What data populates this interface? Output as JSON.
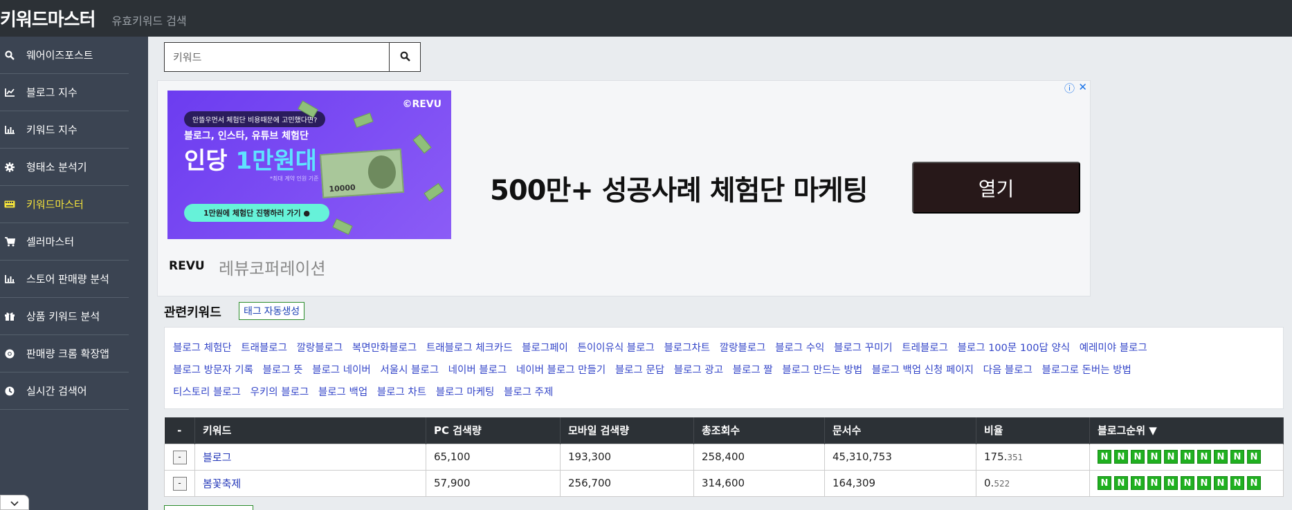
{
  "header": {
    "brand": "키워드마스터",
    "subtitle": "유효키워드 검색"
  },
  "sidebar": {
    "items": [
      {
        "label": "웨어이즈포스트",
        "icon": "search-icon"
      },
      {
        "label": "블로그 지수",
        "icon": "line-chart-icon"
      },
      {
        "label": "키워드 지수",
        "icon": "bar-chart-icon"
      },
      {
        "label": "형태소 분석기",
        "icon": "gear-icon"
      },
      {
        "label": "키워드마스터",
        "icon": "keyboard-icon",
        "active": true
      },
      {
        "label": "셀러마스터",
        "icon": "cart-icon"
      },
      {
        "label": "스토어 판매량 분석",
        "icon": "bar-chart-icon"
      },
      {
        "label": "상품 키워드 분석",
        "icon": "gift-icon"
      },
      {
        "label": "판매량 크롬 확장앱",
        "icon": "chrome-icon"
      },
      {
        "label": "실시간 검색어",
        "icon": "clock-icon"
      }
    ],
    "active_color": "#f5e33a"
  },
  "search": {
    "placeholder": "키워드",
    "value": ""
  },
  "ad": {
    "banner_pill": "안뜰우먼서 체험단 비용때문에 고민했다면?",
    "banner_logo": "©REVU",
    "banner_line1": "블로그, 인스타, 유튜브 체험단",
    "banner_line2_a": "인당 ",
    "banner_line2_b": "1만원대",
    "banner_note": "*최대 계약 인원 기준",
    "banner_bill": "10000",
    "banner_cta": "1만원에 체험단 진행하러 가기 ●",
    "headline": "500만+ 성공사례 체험단 마케팅",
    "open_label": "열기",
    "advertiser_logo": "REVU",
    "advertiser_name": "레뷰코퍼레이션",
    "info_icon": "ⓘ",
    "close_icon": "✕"
  },
  "related": {
    "title": "관련키워드",
    "tag_button": "태그 자동생성",
    "keywords": [
      "블로그 체험단",
      "트래블로그",
      "깔랑블로그",
      "복면만화블로그",
      "트래블로그 체크카드",
      "블로그페이",
      "튼이이유식 블로그",
      "블로그차트",
      "깔랑블로그",
      "블로그 수익",
      "블로그 꾸미기",
      "트레블로그",
      "블로그 100문 100답 양식",
      "예레미야 블로그",
      "블로그 방문자 기록",
      "블로그 뜻",
      "블로그 네이버",
      "서울시 블로그",
      "네이버 블로그",
      "네이버 블로그 만들기",
      "블로그 문답",
      "블로그 광고",
      "블로그 짤",
      "블로그 만드는 방법",
      "블로그 백업 신청 페이지",
      "다음 블로그",
      "블로그로 돈버는 방법",
      "티스토리 블로그",
      "우키의 블로그",
      "블로그 백업",
      "블로그 차트",
      "블로그 마케팅",
      "블로그 주제"
    ]
  },
  "table": {
    "headers": [
      "-",
      "키워드",
      "PC 검색량",
      "모바일 검색량",
      "총조회수",
      "문서수",
      "비율",
      "블로그순위 ▼"
    ],
    "rows": [
      {
        "minus": "-",
        "keyword": "블로그",
        "pc": "65,100",
        "mobile": "193,300",
        "total": "258,400",
        "docs": "45,310,753",
        "ratio_main": "175.",
        "ratio_small": "351",
        "rank": [
          "N",
          "N",
          "N",
          "N",
          "N",
          "N",
          "N",
          "N",
          "N",
          "N"
        ]
      },
      {
        "minus": "-",
        "keyword": "봄꽃축제",
        "pc": "57,900",
        "mobile": "256,700",
        "total": "314,600",
        "docs": "164,309",
        "ratio_main": "0.",
        "ratio_small": "522",
        "rank": [
          "N",
          "N",
          "N",
          "N",
          "N",
          "N",
          "N",
          "N",
          "N",
          "N"
        ]
      }
    ]
  }
}
